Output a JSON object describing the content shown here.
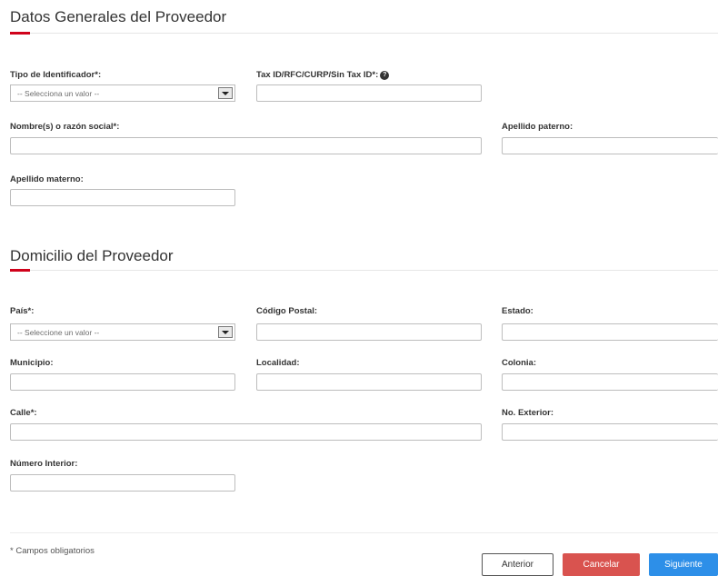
{
  "general": {
    "title": "Datos Generales del Proveedor",
    "tipo_label": "Tipo de Identificador*:",
    "tipo_value": "-- Selecciona un valor --",
    "taxid_label": "Tax ID/RFC/CURP/Sin Tax ID*:",
    "taxid_value": "",
    "nombre_label": "Nombre(s) o razón social*:",
    "nombre_value": "",
    "paterno_label": "Apellido paterno:",
    "paterno_value": "",
    "materno_label": "Apellido materno:",
    "materno_value": ""
  },
  "domicilio": {
    "title": "Domicilio del Proveedor",
    "pais_label": "País*:",
    "pais_value": "-- Seleccione un valor --",
    "cp_label": "Código Postal:",
    "estado_label": "Estado:",
    "municipio_label": "Municipio:",
    "localidad_label": "Localidad:",
    "colonia_label": "Colonia:",
    "calle_label": "Calle*:",
    "exterior_label": "No. Exterior:",
    "interior_label": "Número Interior:"
  },
  "footer": {
    "note": "* Campos obligatorios",
    "prev_label": "Anterior",
    "cancel_label": "Cancelar",
    "next_label": "Siguiente"
  },
  "colors": {
    "accent": "#d0021b",
    "cancel": "#d9534f",
    "next": "#2d8fe8"
  },
  "icons": {
    "help": "question-circle-icon",
    "dropdown": "chevron-down-icon"
  }
}
